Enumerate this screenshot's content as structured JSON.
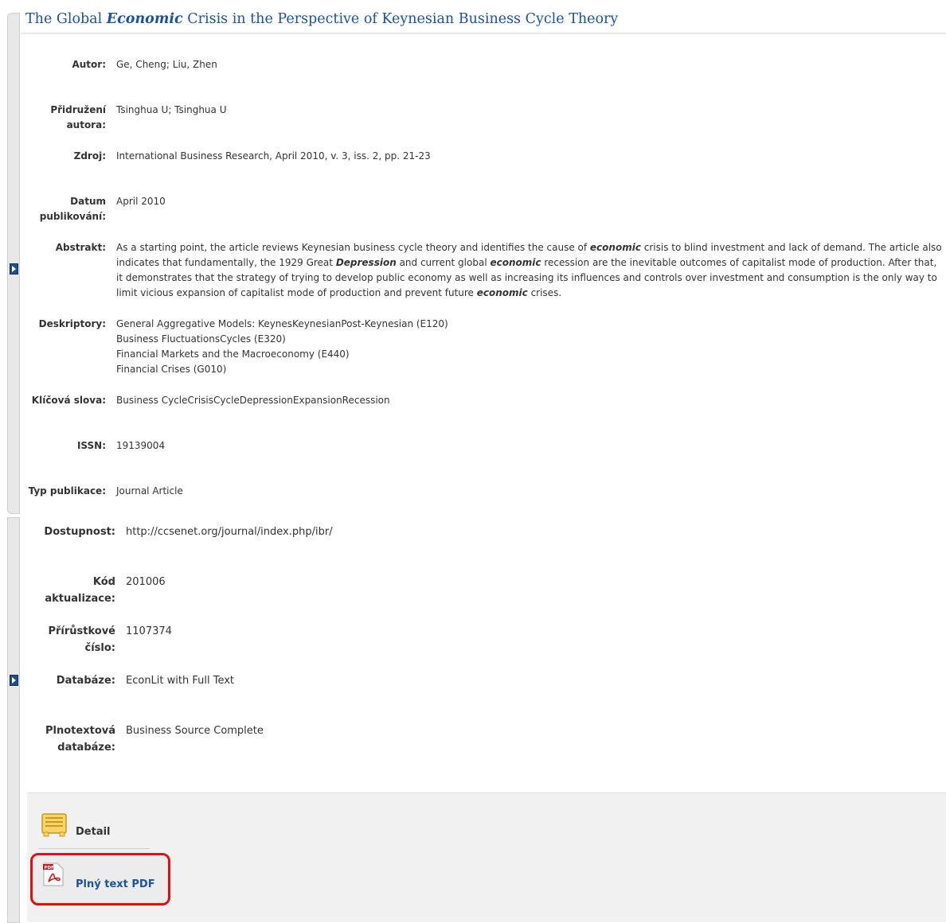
{
  "title_pre": "The Global ",
  "title_em": "Economic",
  "title_post": " Crisis in the Perspective of Keynesian Business Cycle Theory",
  "fields": {
    "autor_label": "Autor:",
    "autor_value": "Ge, Cheng; Liu, Zhen",
    "pridruzeni_label1": "Přidružení",
    "pridruzeni_label2": "autora:",
    "pridruzeni_value": "Tsinghua U; Tsinghua U",
    "zdroj_label": "Zdroj:",
    "zdroj_value": "International Business Research, April 2010, v. 3, iss. 2, pp. 21-23",
    "datum_label1": "Datum",
    "datum_label2": "publikování:",
    "datum_value": "April 2010",
    "abstrakt_label": "Abstrakt:",
    "abstrakt_1": "As a starting point, the article reviews Keynesian business cycle theory and identifies the cause of ",
    "abstrakt_2": "economic",
    "abstrakt_3": " crisis to blind investment and lack of demand. The article also indicates that fundamentally, the 1929 Great ",
    "abstrakt_4": "Depression",
    "abstrakt_5": " and current global ",
    "abstrakt_6": "economic",
    "abstrakt_7": " recession are the inevitable outcomes of capitalist mode of production. After that, it demonstrates that the strategy of trying to develop public economy as well as increasing its influences and controls over investment and consumption is the only way to limit vicious expansion of capitalist mode of production and prevent future ",
    "abstrakt_8": "economic",
    "abstrakt_9": " crises.",
    "deskriptory_label": "Deskriptory:",
    "deskriptory": [
      "General Aggregative Models: KeynesKeynesianPost-Keynesian (E120)",
      "Business FluctuationsCycles (E320)",
      "Financial Markets and the Macroeconomy (E440)",
      "Financial Crises (G010)"
    ],
    "klicova_label": "Klíčová slova:",
    "klicova_value": "Business CycleCrisisCycleDepressionExpansionRecession",
    "issn_label": "ISSN:",
    "issn_value": "19139004",
    "typ_label": "Typ publikace:",
    "typ_value": "Journal Article",
    "dostupnost_label": "Dostupnost:",
    "dostupnost_value": "http://ccsenet.org/journal/index.php/ibr/",
    "kod_label1": "Kód",
    "kod_label2": "aktualizace:",
    "kod_value": "201006",
    "prirustkove_label1": "Přírůstkové",
    "prirustkove_label2": "číslo:",
    "prirustkove_value": "1107374",
    "databaze_label": "Databáze:",
    "databaze_value": "EconLit with Full Text",
    "plnotext_label1": "Plnotextová",
    "plnotext_label2": "databáze:",
    "plnotext_value": "Business Source Complete"
  },
  "actions": {
    "detail_label": "Detail",
    "pdf_label": "Plný text PDF"
  },
  "icons": {
    "detail": "document-icon",
    "pdf": "pdf-icon",
    "toggle": "expand-arrow-icon"
  },
  "colors": {
    "link": "#1a53a0",
    "highlight": "#e11010"
  }
}
